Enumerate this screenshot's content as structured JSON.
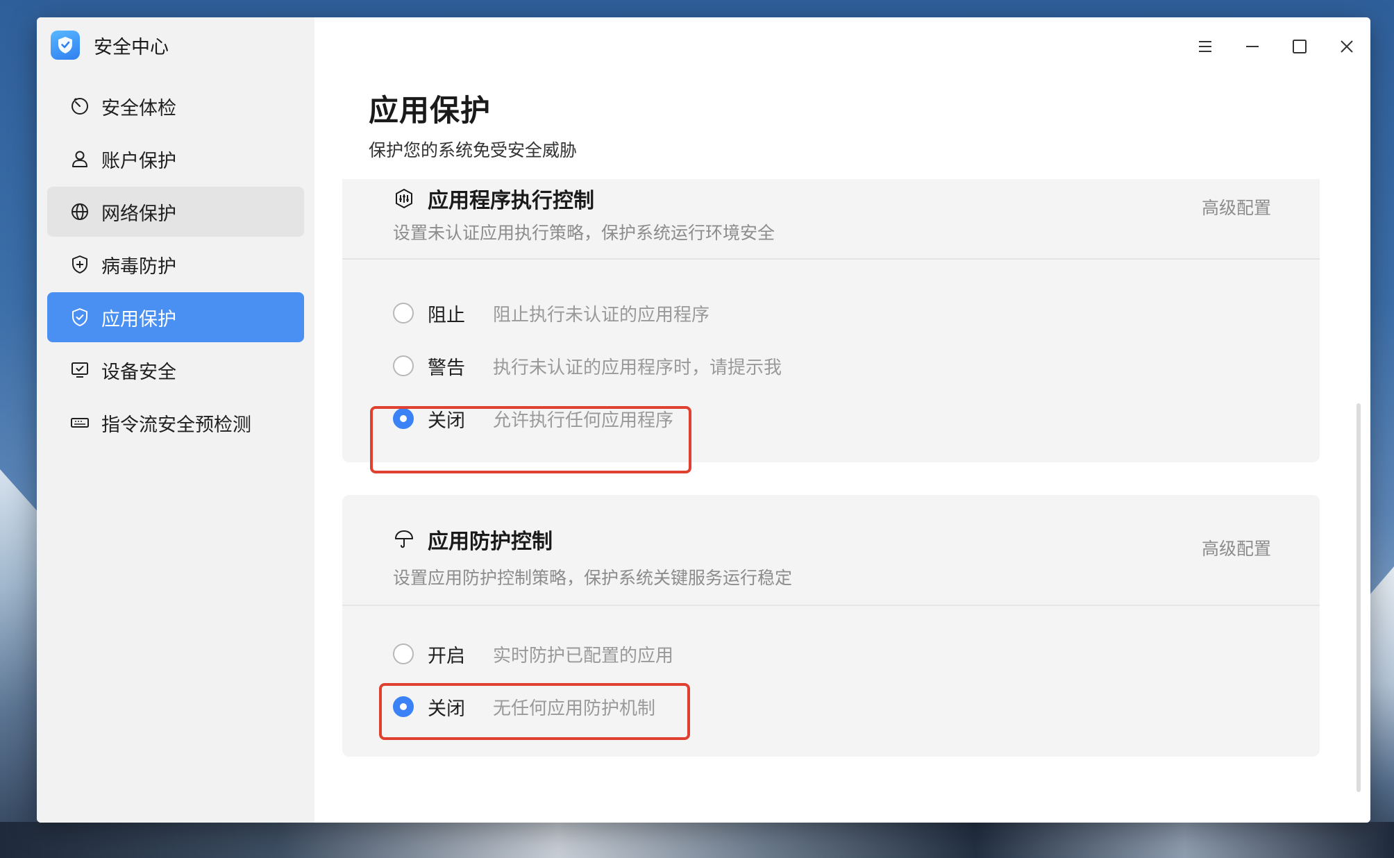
{
  "app": {
    "title": "安全中心",
    "logo_icon": "shield-badge-icon",
    "accent": "#4a8ff2"
  },
  "sidebar": {
    "items": [
      {
        "label": "安全体检",
        "icon": "scan-clock-icon"
      },
      {
        "label": "账户保护",
        "icon": "user-icon"
      },
      {
        "label": "网络保护",
        "icon": "globe-icon"
      },
      {
        "label": "病毒防护",
        "icon": "shield-plus-icon"
      },
      {
        "label": "应用保护",
        "icon": "shield-check-icon"
      },
      {
        "label": "设备安全",
        "icon": "monitor-check-icon"
      },
      {
        "label": "指令流安全预检测",
        "icon": "drive-icon"
      }
    ],
    "active_index": 4,
    "hover_index": 2
  },
  "window_controls": {
    "menu": "menu-icon",
    "minimize": "minimize-icon",
    "maximize": "maximize-icon",
    "close": "close-icon"
  },
  "page": {
    "title": "应用保护",
    "subtitle": "保护您的系统免受安全威胁"
  },
  "sections": [
    {
      "title": "应用程序执行控制",
      "icon": "exec-control-icon",
      "description": "设置未认证应用执行策略，保护系统运行环境安全",
      "advanced_label": "高级配置",
      "options": [
        {
          "label": "阻止",
          "description": "阻止执行未认证的应用程序",
          "checked": false
        },
        {
          "label": "警告",
          "description": "执行未认证的应用程序时，请提示我",
          "checked": false
        },
        {
          "label": "关闭",
          "description": "允许执行任何应用程序",
          "checked": true
        }
      ]
    },
    {
      "title": "应用防护控制",
      "icon": "umbrella-icon",
      "description": "设置应用防护控制策略，保护系统关键服务运行稳定",
      "advanced_label": "高级配置",
      "options": [
        {
          "label": "开启",
          "description": "实时防护已配置的应用",
          "checked": false
        },
        {
          "label": "关闭",
          "description": "无任何应用防护机制",
          "checked": true
        }
      ]
    }
  ],
  "colors": {
    "highlight_box": "#e0402f",
    "radio_checked": "#3b82f6"
  }
}
